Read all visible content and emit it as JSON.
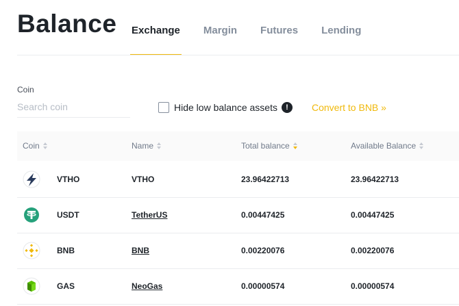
{
  "header": {
    "title": "Balance"
  },
  "tabs": [
    {
      "label": "Exchange",
      "active": true
    },
    {
      "label": "Margin"
    },
    {
      "label": "Futures"
    },
    {
      "label": "Lending"
    }
  ],
  "filter": {
    "coin_label": "Coin",
    "search_placeholder": "Search coin",
    "hide_low_label": "Hide low balance assets",
    "hide_low_checked": false,
    "convert_label": "Convert to BNB »"
  },
  "table": {
    "columns": [
      "Coin",
      "Name",
      "Total balance",
      "Available Balance"
    ],
    "sorted_column": "Total balance",
    "rows": [
      {
        "icon": "vtho-icon",
        "coin": "VTHO",
        "name": "VTHO",
        "total": "23.96422713",
        "available": "23.96422713"
      },
      {
        "icon": "usdt-icon",
        "coin": "USDT",
        "name": "TetherUS",
        "total": "0.00447425",
        "available": "0.00447425"
      },
      {
        "icon": "bnb-icon",
        "coin": "BNB",
        "name": "BNB",
        "total": "0.00220076",
        "available": "0.00220076"
      },
      {
        "icon": "gas-icon",
        "coin": "GAS",
        "name": "NeoGas",
        "total": "0.00000574",
        "available": "0.00000574"
      }
    ]
  },
  "colors": {
    "accent": "#f0b90b",
    "text": "#1e2329",
    "muted": "#848e9c"
  }
}
